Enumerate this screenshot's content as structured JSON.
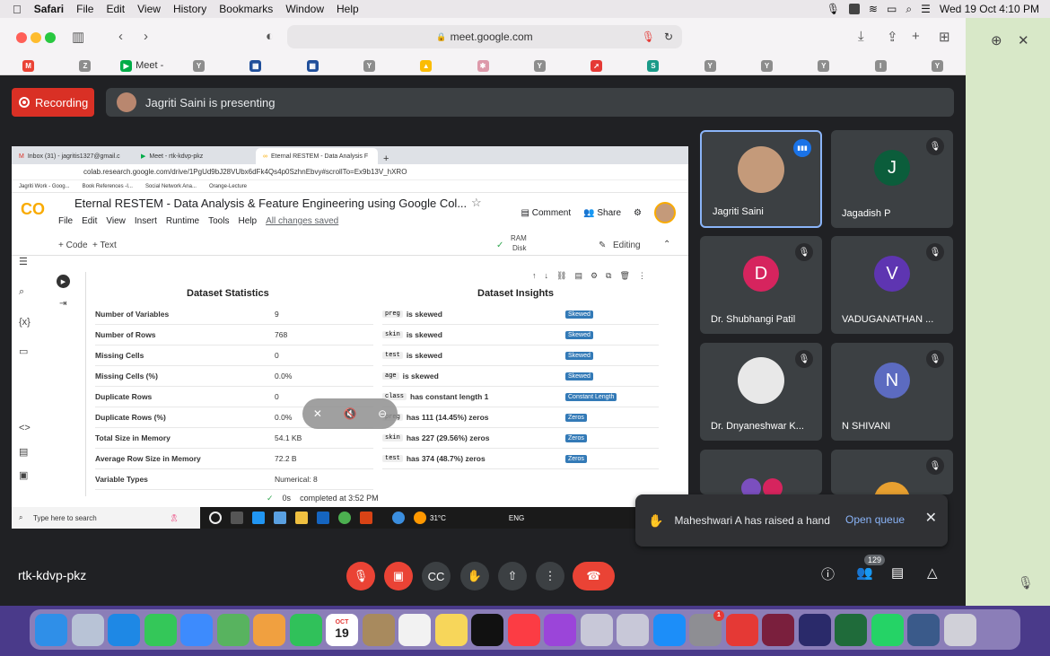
{
  "menubar": {
    "app": "Safari",
    "items": [
      "File",
      "Edit",
      "View",
      "History",
      "Bookmarks",
      "Window",
      "Help"
    ],
    "datetime": "Wed 19 Oct  4:10 PM"
  },
  "safari": {
    "url": "meet.google.com",
    "favorites": [
      {
        "icon": "gmail-icon",
        "label": "",
        "color": "#ea4335",
        "glyph": "M"
      },
      {
        "icon": "z-icon",
        "label": "",
        "color": "#8d8d8d",
        "glyph": "Z"
      },
      {
        "icon": "meet-icon",
        "label": "Meet -",
        "color": "#00ac47",
        "glyph": "▶"
      },
      {
        "icon": "y-icon",
        "label": "",
        "color": "#8d8d8d",
        "glyph": "Y"
      },
      {
        "icon": "flag-icon",
        "label": "",
        "color": "#1f4e9a",
        "glyph": "▦"
      },
      {
        "icon": "flag-icon",
        "label": "",
        "color": "#1f4e9a",
        "glyph": "▦"
      },
      {
        "icon": "y-icon",
        "label": "",
        "color": "#8d8d8d",
        "glyph": "Y"
      },
      {
        "icon": "drive-icon",
        "label": "",
        "color": "#fbbc04",
        "glyph": "▲"
      },
      {
        "icon": "puzzle-icon",
        "label": "",
        "color": "#d9a",
        "glyph": "✱"
      },
      {
        "icon": "y-icon",
        "label": "",
        "color": "#8d8d8d",
        "glyph": "Y"
      },
      {
        "icon": "arrow-icon",
        "label": "",
        "color": "#e53935",
        "glyph": "➚"
      },
      {
        "icon": "s-icon",
        "label": "",
        "color": "#1a9a88",
        "glyph": "S"
      },
      {
        "icon": "y-icon",
        "label": "",
        "color": "#8d8d8d",
        "glyph": "Y"
      },
      {
        "icon": "y-icon",
        "label": "",
        "color": "#8d8d8d",
        "glyph": "Y"
      },
      {
        "icon": "y-icon",
        "label": "",
        "color": "#8d8d8d",
        "glyph": "Y"
      },
      {
        "icon": "i-icon",
        "label": "",
        "color": "#8d8d8d",
        "glyph": "I"
      },
      {
        "icon": "y-icon",
        "label": "",
        "color": "#8d8d8d",
        "glyph": "Y"
      }
    ]
  },
  "meet": {
    "recording_label": "Recording",
    "presenting_label": "Jagriti Saini is presenting",
    "meeting_code": "rtk-kdvp-pkz",
    "participant_count": "129",
    "raise_hand": {
      "message": "Maheshwari A has raised a hand",
      "action": "Open queue"
    },
    "tiles": [
      {
        "name": "Jagriti Saini",
        "initial": "",
        "color": "#c49a7a",
        "speaking": true
      },
      {
        "name": "Jagadish P",
        "initial": "J",
        "color": "#0b5d3b",
        "speaking": false
      },
      {
        "name": "Dr. Shubhangi Patil",
        "initial": "D",
        "color": "#d6245e",
        "speaking": false
      },
      {
        "name": "VADUGANATHAN ...",
        "initial": "V",
        "color": "#5e35b1",
        "speaking": false
      },
      {
        "name": "Dr. Dnyaneshwar K...",
        "initial": "",
        "color": "#e8e8e8",
        "speaking": false
      },
      {
        "name": "N SHIVANI",
        "initial": "N",
        "color": "#5c6bc0",
        "speaking": false
      }
    ]
  },
  "screen": {
    "tabs": [
      "Inbox (31) - jagritis1327@gmail.c",
      "Meet - rtk-kdvp-pkz",
      "Eternal RESTEM - Data Analysis F"
    ],
    "address": "colab.research.google.com/drive/1PgUd9bJ28VUbx6dFk4Qs4p0SzhnEbvy#scrollTo=Ex9b13V_hXRO",
    "bookmarks": [
      "Jagriti Work - Goog...",
      "Book References -I...",
      "Social Network Ana...",
      "Orange-Lecture"
    ],
    "notebook_title": "Eternal RESTEM - Data Analysis & Feature Engineering using Google Col...",
    "menu": [
      "File",
      "Edit",
      "View",
      "Insert",
      "Runtime",
      "Tools",
      "Help"
    ],
    "saved": "All changes saved",
    "comment": "Comment",
    "share": "Share",
    "add_code": "+ Code",
    "add_text": "+ Text",
    "ram": "RAM",
    "disk": "Disk",
    "editing": "Editing",
    "stats_title": "Dataset Statistics",
    "insights_title": "Dataset Insights",
    "stats": [
      {
        "k": "Number of Variables",
        "v": "9"
      },
      {
        "k": "Number of Rows",
        "v": "768"
      },
      {
        "k": "Missing Cells",
        "v": "0"
      },
      {
        "k": "Missing Cells (%)",
        "v": "0.0%"
      },
      {
        "k": "Duplicate Rows",
        "v": "0"
      },
      {
        "k": "Duplicate Rows (%)",
        "v": "0.0%"
      },
      {
        "k": "Total Size in Memory",
        "v": "54.1 KB"
      },
      {
        "k": "Average Row Size in Memory",
        "v": "72.2 B"
      },
      {
        "k": "Variable Types",
        "v": "Numerical: 8"
      }
    ],
    "insights": [
      {
        "code": "preg",
        "text": "is skewed",
        "badge": "Skewed"
      },
      {
        "code": "skin",
        "text": "is skewed",
        "badge": "Skewed"
      },
      {
        "code": "test",
        "text": "is skewed",
        "badge": "Skewed"
      },
      {
        "code": "age",
        "text": "is skewed",
        "badge": "Skewed"
      },
      {
        "code": "class",
        "text": "has constant length 1",
        "badge": "Constant Length"
      },
      {
        "code": "preg",
        "text": "has 111 (14.45%) zeros",
        "badge": "Zeros"
      },
      {
        "code": "skin",
        "text": "has 227 (29.56%) zeros",
        "badge": "Zeros"
      },
      {
        "code": "test",
        "text": "has 374 (48.7%) zeros",
        "badge": "Zeros"
      }
    ],
    "status_time": "0s",
    "status_text": "completed at 3:52 PM",
    "taskbar_search": "Type here to search",
    "temperature": "31°C",
    "lang": "ENG"
  },
  "dock": {
    "calendar_month": "OCT",
    "calendar_day": "19",
    "notification_badge": "1",
    "apps": [
      {
        "name": "finder-icon",
        "color": "#2f8fe8"
      },
      {
        "name": "launchpad-icon",
        "color": "#b8c3d6"
      },
      {
        "name": "safari-icon",
        "color": "#1e88e5"
      },
      {
        "name": "messages-icon",
        "color": "#34c759"
      },
      {
        "name": "mail-icon",
        "color": "#3d8bfd"
      },
      {
        "name": "maps-icon",
        "color": "#58b35f"
      },
      {
        "name": "photos-icon",
        "color": "#f0a040"
      },
      {
        "name": "facetime-icon",
        "color": "#30c15a"
      },
      {
        "name": "calendar-icon",
        "color": "#ffffff"
      },
      {
        "name": "contacts-icon",
        "color": "#a88a5e"
      },
      {
        "name": "reminders-icon",
        "color": "#f2f2f2"
      },
      {
        "name": "notes-icon",
        "color": "#f7d65a"
      },
      {
        "name": "tv-icon",
        "color": "#111111"
      },
      {
        "name": "music-icon",
        "color": "#fc3c44"
      },
      {
        "name": "podcasts-icon",
        "color": "#9b45d9"
      },
      {
        "name": "unknown-icon",
        "color": "#c8c8d8"
      },
      {
        "name": "unknown-icon",
        "color": "#c8c8d8"
      },
      {
        "name": "appstore-icon",
        "color": "#1c8ef9"
      },
      {
        "name": "settings-icon",
        "color": "#8e8e93"
      },
      {
        "name": "wps-icon",
        "color": "#e53935"
      },
      {
        "name": "app-red-icon",
        "color": "#7a1f3d"
      },
      {
        "name": "app-blue-icon",
        "color": "#2a2a6a"
      },
      {
        "name": "app-green-icon",
        "color": "#1f6b3a"
      },
      {
        "name": "whatsapp-icon",
        "color": "#25d366"
      },
      {
        "name": "document-icon",
        "color": "#3a5a8a"
      },
      {
        "name": "trash-icon",
        "color": "#d0d0d8"
      }
    ]
  }
}
